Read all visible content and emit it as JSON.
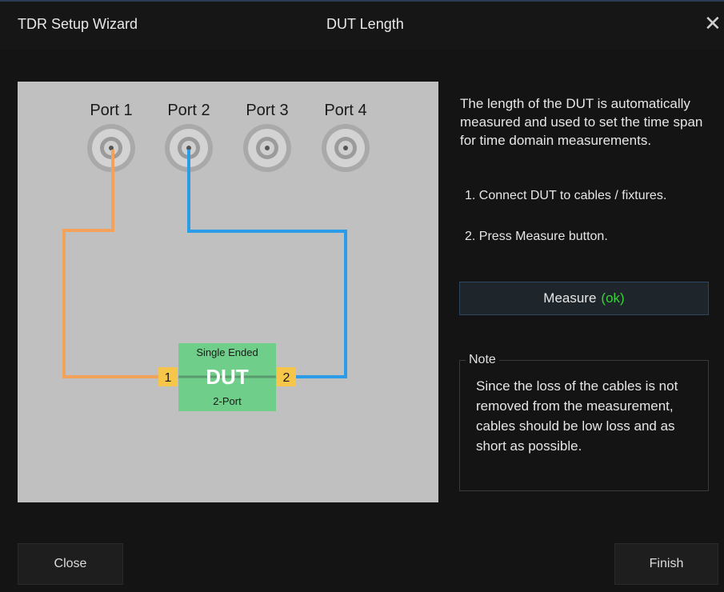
{
  "window": {
    "title": "TDR Setup Wizard",
    "page_title": "DUT Length",
    "close_icon": "close-icon"
  },
  "diagram": {
    "ports": [
      "Port 1",
      "Port 2",
      "Port 3",
      "Port 4"
    ],
    "dut": {
      "top_label": "Single Ended",
      "name": "DUT",
      "bottom_label": "2-Port",
      "pin1": "1",
      "pin2": "2"
    },
    "colors": {
      "background": "#c0c0c0",
      "cable1": "#f2a25a",
      "cable2": "#2b9de8",
      "dut": "#6fcf8a",
      "pin": "#f5c64a"
    }
  },
  "description": "The length of the DUT is automatically measured and used to set the time span for time domain measurements.",
  "steps": [
    "1. Connect DUT to cables / fixtures.",
    "2. Press Measure button."
  ],
  "measure_button": {
    "label": "Measure",
    "status": "(ok)"
  },
  "note": {
    "label": "Note",
    "text": "Since the loss of the cables is not removed from the measurement, cables should be low loss and as short as possible."
  },
  "footer": {
    "close_label": "Close",
    "finish_label": "Finish"
  }
}
